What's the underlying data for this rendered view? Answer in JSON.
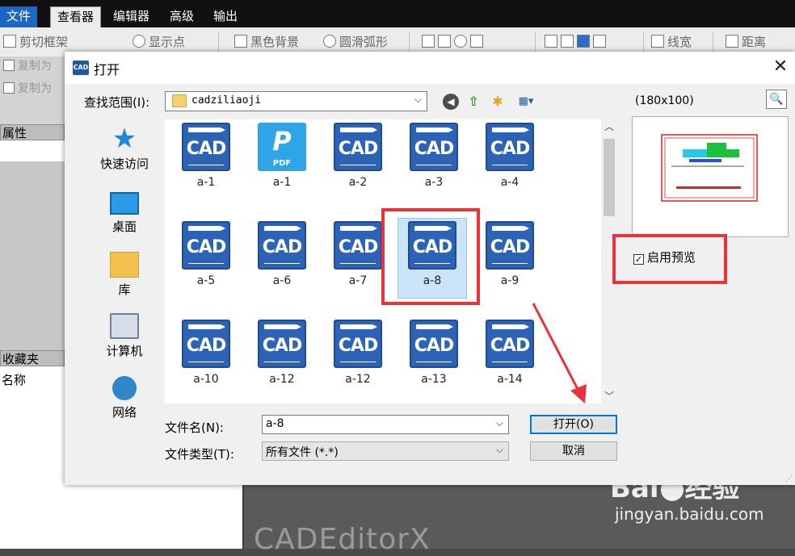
{
  "app": {
    "menu": [
      {
        "label": "文件",
        "key": "file"
      },
      {
        "label": "查看器",
        "key": "viewer"
      },
      {
        "label": "编辑器",
        "key": "editor"
      },
      {
        "label": "高级",
        "key": "advanced"
      },
      {
        "label": "输出",
        "key": "output"
      }
    ],
    "toolbar": {
      "clip_frame": "剪切框架",
      "show_points": "显示点",
      "black_background": "黑色背景",
      "smooth_arcs": "圆滑弧形",
      "line_width": "线宽",
      "distance": "距离"
    },
    "left": {
      "copy_as_1": "复制为",
      "copy_as_2": "复制为",
      "properties_header": "属性",
      "favorites_header": "收藏夹",
      "name_label": "名称"
    },
    "brand_text": "CADEditorX"
  },
  "watermark": {
    "title_left": "Bai",
    "title_right": "经验",
    "url": "jingyan.baidu.com"
  },
  "dialog": {
    "logo_text": "CAD",
    "title": "打开",
    "close_label": "✕",
    "look_in_label": "查找范围(I):",
    "look_in_value": "cadziliaoji",
    "places": [
      {
        "label": "快速访问",
        "icon": "star-icon"
      },
      {
        "label": "桌面",
        "icon": "desktop-icon"
      },
      {
        "label": "库",
        "icon": "library-icon"
      },
      {
        "label": "计算机",
        "icon": "computer-icon"
      },
      {
        "label": "网络",
        "icon": "network-icon"
      }
    ],
    "files": [
      {
        "label": "a-1",
        "type": "cad"
      },
      {
        "label": "a-1",
        "type": "pdf"
      },
      {
        "label": "a-2",
        "type": "cad"
      },
      {
        "label": "a-3",
        "type": "cad"
      },
      {
        "label": "a-4",
        "type": "cad"
      },
      {
        "label": "a-5",
        "type": "cad"
      },
      {
        "label": "a-6",
        "type": "cad"
      },
      {
        "label": "a-7",
        "type": "cad"
      },
      {
        "label": "a-8",
        "type": "cad",
        "selected": true
      },
      {
        "label": "a-9",
        "type": "cad"
      },
      {
        "label": "a-10",
        "type": "cad"
      },
      {
        "label": "a-12",
        "type": "cad"
      },
      {
        "label": "a-12",
        "type": "cad"
      },
      {
        "label": "a-13",
        "type": "cad"
      },
      {
        "label": "a-14",
        "type": "cad"
      }
    ],
    "cad_icon_text": "CAD",
    "pdf_icon_text": "PDF",
    "file_name_label": "文件名(N):",
    "file_name_value": "a-8",
    "file_type_label": "文件类型(T):",
    "file_type_value": "所有文件 (*.*)",
    "open_button": "打开(O)",
    "cancel_button": "取消",
    "preview_size": "(180x100)",
    "enable_preview_label": "启用预览",
    "enable_preview_checked": true
  },
  "colors": {
    "highlight_red": "#e8333a",
    "cad_icon_blue": "#2d63b6",
    "selection_blue": "#cce4f7"
  }
}
